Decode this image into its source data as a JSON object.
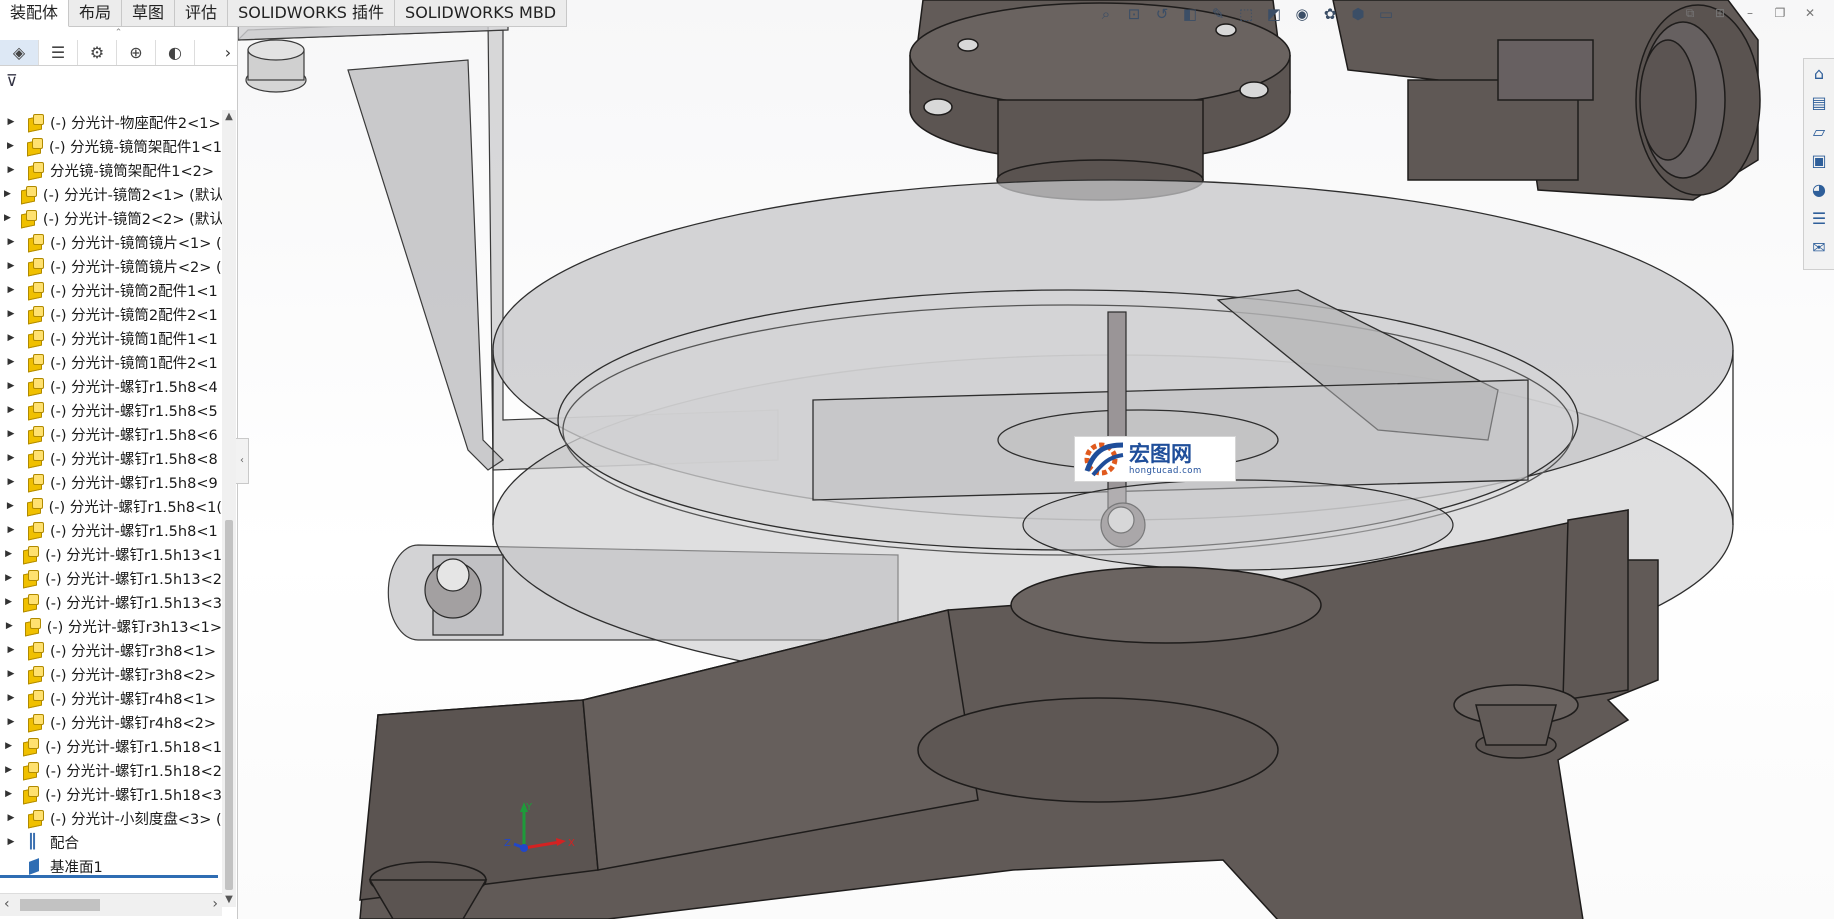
{
  "tabs": [
    "装配体",
    "布局",
    "草图",
    "评估",
    "SOLIDWORKS 插件",
    "SOLIDWORKS MBD"
  ],
  "active_tab": "装配体",
  "feature_tree": {
    "items": [
      {
        "label": "(-) 分光计-物座配件2<1>",
        "icon": "part-icon"
      },
      {
        "label": "(-) 分光镜-镜筒架配件1<1",
        "icon": "part-icon"
      },
      {
        "label": "分光镜-镜筒架配件1<2>",
        "icon": "part-icon"
      },
      {
        "label": "(-) 分光计-镜筒2<1> (默认",
        "icon": "part-icon"
      },
      {
        "label": "(-) 分光计-镜筒2<2> (默认",
        "icon": "part-icon"
      },
      {
        "label": "(-) 分光计-镜筒镜片<1> (",
        "icon": "part-icon"
      },
      {
        "label": "(-) 分光计-镜筒镜片<2> (",
        "icon": "part-icon"
      },
      {
        "label": "(-) 分光计-镜筒2配件1<1",
        "icon": "part-icon"
      },
      {
        "label": "(-) 分光计-镜筒2配件2<1",
        "icon": "part-icon"
      },
      {
        "label": "(-) 分光计-镜筒1配件1<1",
        "icon": "part-icon"
      },
      {
        "label": "(-) 分光计-镜筒1配件2<1",
        "icon": "part-icon"
      },
      {
        "label": "(-) 分光计-螺钉r1.5h8<4",
        "icon": "part-icon"
      },
      {
        "label": "(-) 分光计-螺钉r1.5h8<5",
        "icon": "part-icon"
      },
      {
        "label": "(-) 分光计-螺钉r1.5h8<6",
        "icon": "part-icon"
      },
      {
        "label": "(-) 分光计-螺钉r1.5h8<8",
        "icon": "part-icon"
      },
      {
        "label": "(-) 分光计-螺钉r1.5h8<9",
        "icon": "part-icon"
      },
      {
        "label": "(-) 分光计-螺钉r1.5h8<1(",
        "icon": "part-icon"
      },
      {
        "label": "(-) 分光计-螺钉r1.5h8<1",
        "icon": "part-icon"
      },
      {
        "label": "(-) 分光计-螺钉r1.5h13<1",
        "icon": "part-icon"
      },
      {
        "label": "(-) 分光计-螺钉r1.5h13<2",
        "icon": "part-icon"
      },
      {
        "label": "(-) 分光计-螺钉r1.5h13<3",
        "icon": "part-icon"
      },
      {
        "label": "(-) 分光计-螺钉r3h13<1>",
        "icon": "part-icon"
      },
      {
        "label": "(-) 分光计-螺钉r3h8<1>",
        "icon": "part-icon"
      },
      {
        "label": "(-) 分光计-螺钉r3h8<2>",
        "icon": "part-icon"
      },
      {
        "label": "(-) 分光计-螺钉r4h8<1>",
        "icon": "part-icon"
      },
      {
        "label": "(-) 分光计-螺钉r4h8<2>",
        "icon": "part-icon"
      },
      {
        "label": "(-) 分光计-螺钉r1.5h18<1",
        "icon": "part-icon"
      },
      {
        "label": "(-) 分光计-螺钉r1.5h18<2",
        "icon": "part-icon"
      },
      {
        "label": "(-) 分光计-螺钉r1.5h18<3",
        "icon": "part-icon"
      },
      {
        "label": "(-) 分光计-小刻度盘<3> (",
        "icon": "part-icon"
      },
      {
        "label": "配合",
        "icon": "mate-icon"
      },
      {
        "label": "基准面1",
        "icon": "plane-icon"
      }
    ]
  },
  "watermark": {
    "main": "宏图网",
    "sub": "hongtucad.com"
  },
  "triad": {
    "x": "X",
    "y": "Y",
    "z": "Z"
  },
  "colors": {
    "metal": "#615a57",
    "metal_edge": "#1e1c1b",
    "glass": "#c4c4c6",
    "accent": "#2f6db3"
  }
}
